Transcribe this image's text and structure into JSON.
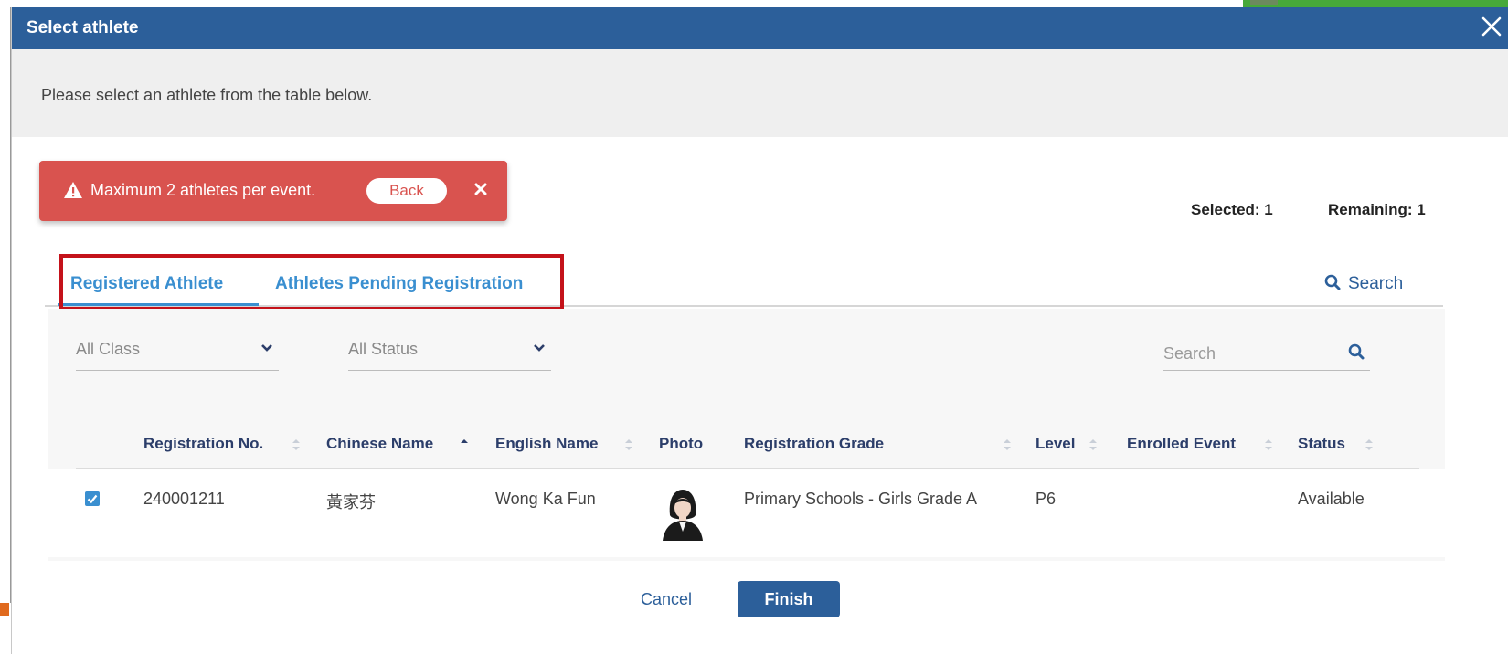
{
  "dialog": {
    "title": "Select athlete",
    "instruction": "Please select an athlete from the table below."
  },
  "alert": {
    "message": "Maximum 2 athletes per event.",
    "back_label": "Back"
  },
  "counts": {
    "selected": "Selected: 1",
    "remaining": "Remaining: 1"
  },
  "tabs": [
    {
      "label": "Registered Athlete",
      "active": true
    },
    {
      "label": "Athletes Pending Registration",
      "active": false
    }
  ],
  "search_link": "Search",
  "filters": {
    "class_value": "All Class",
    "status_value": "All Status",
    "search_placeholder": "Search"
  },
  "table": {
    "columns": [
      "Registration No.",
      "Chinese Name",
      "English Name",
      "Photo",
      "Registration Grade",
      "Level",
      "Enrolled Event",
      "Status"
    ],
    "rows": [
      {
        "checked": true,
        "registration_no": "240001211",
        "chinese_name": "黃家芬",
        "english_name": "Wong Ka Fun",
        "registration_grade": "Primary Schools - Girls Grade A",
        "level": "P6",
        "enrolled_event": "",
        "status": "Available"
      }
    ]
  },
  "footer": {
    "cancel_label": "Cancel",
    "finish_label": "Finish"
  },
  "colors": {
    "titlebar": "#2c5f9a",
    "alert": "#d9534f",
    "tab_accent": "#3a8fd0",
    "highlight": "#c4121a"
  }
}
